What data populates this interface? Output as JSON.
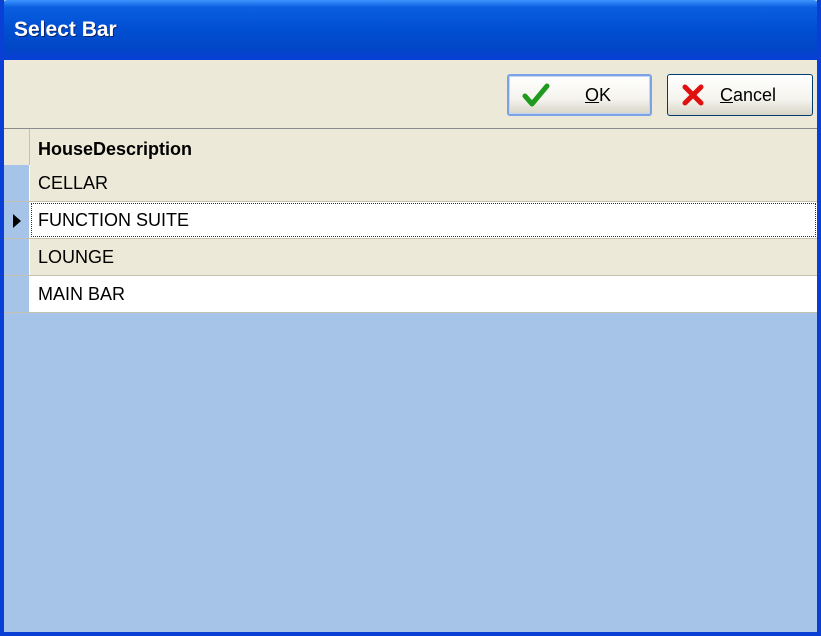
{
  "window": {
    "title": "Select Bar"
  },
  "toolbar": {
    "ok_label_mnemonic": "O",
    "ok_label_rest": "K",
    "cancel_label_mnemonic": "C",
    "cancel_label_rest": "ancel",
    "ok_icon": "checkmark-icon",
    "cancel_icon": "red-x-icon",
    "ok_icon_color": "#1f9a1f",
    "cancel_icon_color": "#e01010"
  },
  "grid": {
    "column_header": "HouseDescription",
    "rows": [
      {
        "value": "CELLAR"
      },
      {
        "value": "FUNCTION SUITE"
      },
      {
        "value": "LOUNGE"
      },
      {
        "value": "MAIN BAR"
      }
    ],
    "selected_index": 1,
    "background_color": "#a6c3e8"
  }
}
